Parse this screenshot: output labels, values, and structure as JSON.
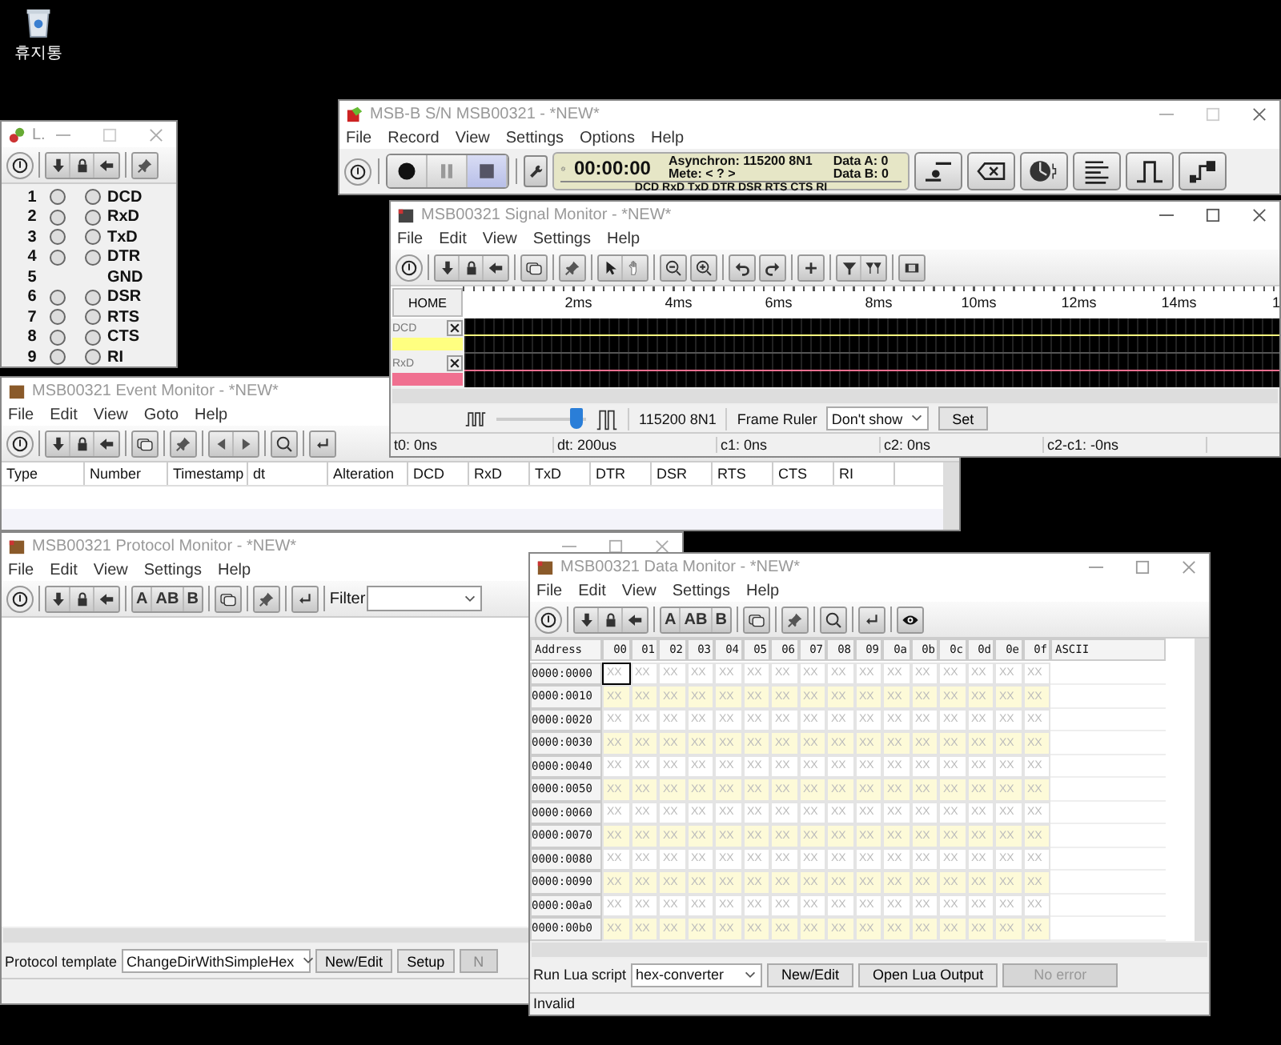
{
  "desktop": {
    "icons": [
      {
        "label": "휴지통"
      }
    ]
  },
  "line_window": {
    "title": "L.",
    "rows": [
      {
        "kind": "signal",
        "pin": "1",
        "name": "DCD",
        "leds_on": false
      },
      {
        "kind": "signal",
        "pin": "2",
        "name": "RxD",
        "leds_on": false
      },
      {
        "kind": "signal",
        "pin": "3",
        "name": "TxD",
        "leds_on": false
      },
      {
        "kind": "signal",
        "pin": "4",
        "name": "DTR",
        "leds_on": false
      },
      {
        "kind": "ground",
        "pin": "5",
        "name": "GND"
      },
      {
        "kind": "signal",
        "pin": "6",
        "name": "DSR",
        "leds_on": false
      },
      {
        "kind": "signal",
        "pin": "7",
        "name": "RTS",
        "leds_on": false
      },
      {
        "kind": "signal",
        "pin": "8",
        "name": "CTS",
        "leds_on": false
      },
      {
        "kind": "signal",
        "pin": "9",
        "name": "RI",
        "leds_on": false
      }
    ]
  },
  "main_window": {
    "title": "MSB-B S/N MSB00321 - *NEW*",
    "menu": [
      "File",
      "Record",
      "View",
      "Settings",
      "Options",
      "Help"
    ],
    "transport": [
      {
        "kind": "record",
        "selected": false
      },
      {
        "kind": "pause",
        "selected": false
      },
      {
        "kind": "stop",
        "selected": true
      }
    ],
    "status": {
      "time": "00:00:00",
      "mode": "Asynchron: 115200 8N1",
      "meter": "Mete: < ? >",
      "data_a": "Data A: 0",
      "data_b": "Data B: 0",
      "lines": "DCD RxD TxD DTR DSR RTS CTS RI"
    }
  },
  "event_monitor": {
    "title": "MSB00321 Event Monitor - *NEW*",
    "menu": [
      "File",
      "Edit",
      "View",
      "Goto",
      "Help"
    ],
    "columns": [
      "Type",
      "Number",
      "Timestamp",
      "dt",
      "Alteration",
      "DCD",
      "RxD",
      "TxD",
      "DTR",
      "DSR",
      "RTS",
      "CTS",
      "RI"
    ]
  },
  "signal_monitor": {
    "title": "MSB00321 Signal Monitor - *NEW*",
    "menu": [
      "File",
      "Edit",
      "View",
      "Settings",
      "Help"
    ],
    "home": "HOME",
    "ruler": [
      "2ms",
      "4ms",
      "6ms",
      "8ms",
      "10ms",
      "12ms",
      "14ms",
      "1"
    ],
    "channels": [
      {
        "name": "DCD",
        "color": "#ffff80"
      },
      {
        "name": "RxD",
        "color": "#f07090"
      }
    ],
    "zoom": {
      "level": 0.9
    },
    "baud": "115200 8N1",
    "frame_ruler": {
      "label": "Frame Ruler",
      "value": "Don't show",
      "button": "Set"
    },
    "status": [
      "t0: 0ns",
      "dt: 200us",
      "c1: 0ns",
      "c2: 0ns",
      "c2-c1: -0ns"
    ]
  },
  "protocol_monitor": {
    "title": "MSB00321 Protocol Monitor - *NEW*",
    "menu": [
      "File",
      "Edit",
      "View",
      "Settings",
      "Help"
    ],
    "display_buttons": [
      "A",
      "AB",
      "B"
    ],
    "filter_label": "Filter",
    "template_label": "Protocol template",
    "template": "ChangeDirWithSimpleHex",
    "buttons": [
      {
        "label": "New/Edit",
        "disabled": false
      },
      {
        "label": "Setup",
        "disabled": false
      },
      {
        "label": "N",
        "disabled": true
      }
    ]
  },
  "data_monitor": {
    "title": "MSB00321 Data Monitor - *NEW*",
    "menu": [
      "File",
      "Edit",
      "View",
      "Settings",
      "Help"
    ],
    "display_buttons": [
      "A",
      "AB",
      "B"
    ],
    "columns": [
      "Address",
      "00",
      "01",
      "02",
      "03",
      "04",
      "05",
      "06",
      "07",
      "08",
      "09",
      "0a",
      "0b",
      "0c",
      "0d",
      "0e",
      "0f",
      "ASCII"
    ],
    "rows": [
      {
        "address": "0000:0000",
        "cells": [
          {
            "text": "XX",
            "selected": true
          },
          {
            "text": "XX",
            "selected": false
          },
          {
            "text": "XX",
            "selected": false
          },
          {
            "text": "XX",
            "selected": false
          },
          {
            "text": "XX",
            "selected": false
          },
          {
            "text": "XX",
            "selected": false
          },
          {
            "text": "XX",
            "selected": false
          },
          {
            "text": "XX",
            "selected": false
          },
          {
            "text": "XX",
            "selected": false
          },
          {
            "text": "XX",
            "selected": false
          },
          {
            "text": "XX",
            "selected": false
          },
          {
            "text": "XX",
            "selected": false
          },
          {
            "text": "XX",
            "selected": false
          },
          {
            "text": "XX",
            "selected": false
          },
          {
            "text": "XX",
            "selected": false
          },
          {
            "text": "XX",
            "selected": false
          }
        ]
      },
      {
        "address": "0000:0010",
        "cells": [
          {
            "text": "XX",
            "selected": false
          },
          {
            "text": "XX",
            "selected": false
          },
          {
            "text": "XX",
            "selected": false
          },
          {
            "text": "XX",
            "selected": false
          },
          {
            "text": "XX",
            "selected": false
          },
          {
            "text": "XX",
            "selected": false
          },
          {
            "text": "XX",
            "selected": false
          },
          {
            "text": "XX",
            "selected": false
          },
          {
            "text": "XX",
            "selected": false
          },
          {
            "text": "XX",
            "selected": false
          },
          {
            "text": "XX",
            "selected": false
          },
          {
            "text": "XX",
            "selected": false
          },
          {
            "text": "XX",
            "selected": false
          },
          {
            "text": "XX",
            "selected": false
          },
          {
            "text": "XX",
            "selected": false
          },
          {
            "text": "XX",
            "selected": false
          }
        ]
      },
      {
        "address": "0000:0020",
        "cells": [
          {
            "text": "XX",
            "selected": false
          },
          {
            "text": "XX",
            "selected": false
          },
          {
            "text": "XX",
            "selected": false
          },
          {
            "text": "XX",
            "selected": false
          },
          {
            "text": "XX",
            "selected": false
          },
          {
            "text": "XX",
            "selected": false
          },
          {
            "text": "XX",
            "selected": false
          },
          {
            "text": "XX",
            "selected": false
          },
          {
            "text": "XX",
            "selected": false
          },
          {
            "text": "XX",
            "selected": false
          },
          {
            "text": "XX",
            "selected": false
          },
          {
            "text": "XX",
            "selected": false
          },
          {
            "text": "XX",
            "selected": false
          },
          {
            "text": "XX",
            "selected": false
          },
          {
            "text": "XX",
            "selected": false
          },
          {
            "text": "XX",
            "selected": false
          }
        ]
      },
      {
        "address": "0000:0030",
        "cells": [
          {
            "text": "XX",
            "selected": false
          },
          {
            "text": "XX",
            "selected": false
          },
          {
            "text": "XX",
            "selected": false
          },
          {
            "text": "XX",
            "selected": false
          },
          {
            "text": "XX",
            "selected": false
          },
          {
            "text": "XX",
            "selected": false
          },
          {
            "text": "XX",
            "selected": false
          },
          {
            "text": "XX",
            "selected": false
          },
          {
            "text": "XX",
            "selected": false
          },
          {
            "text": "XX",
            "selected": false
          },
          {
            "text": "XX",
            "selected": false
          },
          {
            "text": "XX",
            "selected": false
          },
          {
            "text": "XX",
            "selected": false
          },
          {
            "text": "XX",
            "selected": false
          },
          {
            "text": "XX",
            "selected": false
          },
          {
            "text": "XX",
            "selected": false
          }
        ]
      },
      {
        "address": "0000:0040",
        "cells": [
          {
            "text": "XX",
            "selected": false
          },
          {
            "text": "XX",
            "selected": false
          },
          {
            "text": "XX",
            "selected": false
          },
          {
            "text": "XX",
            "selected": false
          },
          {
            "text": "XX",
            "selected": false
          },
          {
            "text": "XX",
            "selected": false
          },
          {
            "text": "XX",
            "selected": false
          },
          {
            "text": "XX",
            "selected": false
          },
          {
            "text": "XX",
            "selected": false
          },
          {
            "text": "XX",
            "selected": false
          },
          {
            "text": "XX",
            "selected": false
          },
          {
            "text": "XX",
            "selected": false
          },
          {
            "text": "XX",
            "selected": false
          },
          {
            "text": "XX",
            "selected": false
          },
          {
            "text": "XX",
            "selected": false
          },
          {
            "text": "XX",
            "selected": false
          }
        ]
      },
      {
        "address": "0000:0050",
        "cells": [
          {
            "text": "XX",
            "selected": false
          },
          {
            "text": "XX",
            "selected": false
          },
          {
            "text": "XX",
            "selected": false
          },
          {
            "text": "XX",
            "selected": false
          },
          {
            "text": "XX",
            "selected": false
          },
          {
            "text": "XX",
            "selected": false
          },
          {
            "text": "XX",
            "selected": false
          },
          {
            "text": "XX",
            "selected": false
          },
          {
            "text": "XX",
            "selected": false
          },
          {
            "text": "XX",
            "selected": false
          },
          {
            "text": "XX",
            "selected": false
          },
          {
            "text": "XX",
            "selected": false
          },
          {
            "text": "XX",
            "selected": false
          },
          {
            "text": "XX",
            "selected": false
          },
          {
            "text": "XX",
            "selected": false
          },
          {
            "text": "XX",
            "selected": false
          }
        ]
      },
      {
        "address": "0000:0060",
        "cells": [
          {
            "text": "XX",
            "selected": false
          },
          {
            "text": "XX",
            "selected": false
          },
          {
            "text": "XX",
            "selected": false
          },
          {
            "text": "XX",
            "selected": false
          },
          {
            "text": "XX",
            "selected": false
          },
          {
            "text": "XX",
            "selected": false
          },
          {
            "text": "XX",
            "selected": false
          },
          {
            "text": "XX",
            "selected": false
          },
          {
            "text": "XX",
            "selected": false
          },
          {
            "text": "XX",
            "selected": false
          },
          {
            "text": "XX",
            "selected": false
          },
          {
            "text": "XX",
            "selected": false
          },
          {
            "text": "XX",
            "selected": false
          },
          {
            "text": "XX",
            "selected": false
          },
          {
            "text": "XX",
            "selected": false
          },
          {
            "text": "XX",
            "selected": false
          }
        ]
      },
      {
        "address": "0000:0070",
        "cells": [
          {
            "text": "XX",
            "selected": false
          },
          {
            "text": "XX",
            "selected": false
          },
          {
            "text": "XX",
            "selected": false
          },
          {
            "text": "XX",
            "selected": false
          },
          {
            "text": "XX",
            "selected": false
          },
          {
            "text": "XX",
            "selected": false
          },
          {
            "text": "XX",
            "selected": false
          },
          {
            "text": "XX",
            "selected": false
          },
          {
            "text": "XX",
            "selected": false
          },
          {
            "text": "XX",
            "selected": false
          },
          {
            "text": "XX",
            "selected": false
          },
          {
            "text": "XX",
            "selected": false
          },
          {
            "text": "XX",
            "selected": false
          },
          {
            "text": "XX",
            "selected": false
          },
          {
            "text": "XX",
            "selected": false
          },
          {
            "text": "XX",
            "selected": false
          }
        ]
      },
      {
        "address": "0000:0080",
        "cells": [
          {
            "text": "XX",
            "selected": false
          },
          {
            "text": "XX",
            "selected": false
          },
          {
            "text": "XX",
            "selected": false
          },
          {
            "text": "XX",
            "selected": false
          },
          {
            "text": "XX",
            "selected": false
          },
          {
            "text": "XX",
            "selected": false
          },
          {
            "text": "XX",
            "selected": false
          },
          {
            "text": "XX",
            "selected": false
          },
          {
            "text": "XX",
            "selected": false
          },
          {
            "text": "XX",
            "selected": false
          },
          {
            "text": "XX",
            "selected": false
          },
          {
            "text": "XX",
            "selected": false
          },
          {
            "text": "XX",
            "selected": false
          },
          {
            "text": "XX",
            "selected": false
          },
          {
            "text": "XX",
            "selected": false
          },
          {
            "text": "XX",
            "selected": false
          }
        ]
      },
      {
        "address": "0000:0090",
        "cells": [
          {
            "text": "XX",
            "selected": false
          },
          {
            "text": "XX",
            "selected": false
          },
          {
            "text": "XX",
            "selected": false
          },
          {
            "text": "XX",
            "selected": false
          },
          {
            "text": "XX",
            "selected": false
          },
          {
            "text": "XX",
            "selected": false
          },
          {
            "text": "XX",
            "selected": false
          },
          {
            "text": "XX",
            "selected": false
          },
          {
            "text": "XX",
            "selected": false
          },
          {
            "text": "XX",
            "selected": false
          },
          {
            "text": "XX",
            "selected": false
          },
          {
            "text": "XX",
            "selected": false
          },
          {
            "text": "XX",
            "selected": false
          },
          {
            "text": "XX",
            "selected": false
          },
          {
            "text": "XX",
            "selected": false
          },
          {
            "text": "XX",
            "selected": false
          }
        ]
      },
      {
        "address": "0000:00a0",
        "cells": [
          {
            "text": "XX",
            "selected": false
          },
          {
            "text": "XX",
            "selected": false
          },
          {
            "text": "XX",
            "selected": false
          },
          {
            "text": "XX",
            "selected": false
          },
          {
            "text": "XX",
            "selected": false
          },
          {
            "text": "XX",
            "selected": false
          },
          {
            "text": "XX",
            "selected": false
          },
          {
            "text": "XX",
            "selected": false
          },
          {
            "text": "XX",
            "selected": false
          },
          {
            "text": "XX",
            "selected": false
          },
          {
            "text": "XX",
            "selected": false
          },
          {
            "text": "XX",
            "selected": false
          },
          {
            "text": "XX",
            "selected": false
          },
          {
            "text": "XX",
            "selected": false
          },
          {
            "text": "XX",
            "selected": false
          },
          {
            "text": "XX",
            "selected": false
          }
        ]
      },
      {
        "address": "0000:00b0",
        "cells": [
          {
            "text": "XX",
            "selected": false
          },
          {
            "text": "XX",
            "selected": false
          },
          {
            "text": "XX",
            "selected": false
          },
          {
            "text": "XX",
            "selected": false
          },
          {
            "text": "XX",
            "selected": false
          },
          {
            "text": "XX",
            "selected": false
          },
          {
            "text": "XX",
            "selected": false
          },
          {
            "text": "XX",
            "selected": false
          },
          {
            "text": "XX",
            "selected": false
          },
          {
            "text": "XX",
            "selected": false
          },
          {
            "text": "XX",
            "selected": false
          },
          {
            "text": "XX",
            "selected": false
          },
          {
            "text": "XX",
            "selected": false
          },
          {
            "text": "XX",
            "selected": false
          },
          {
            "text": "XX",
            "selected": false
          },
          {
            "text": "XX",
            "selected": false
          }
        ]
      }
    ],
    "lua_label": "Run Lua script",
    "script": "hex-converter",
    "buttons": [
      {
        "label": "New/Edit",
        "disabled": false
      },
      {
        "label": "Open Lua Output",
        "disabled": false
      },
      {
        "label": "No error",
        "disabled": true
      }
    ],
    "status": "Invalid"
  }
}
